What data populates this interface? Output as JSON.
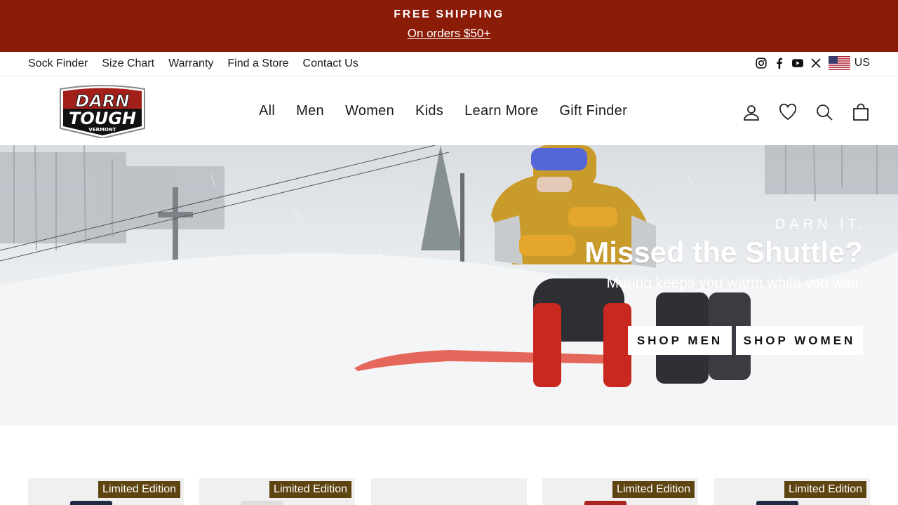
{
  "announcement": {
    "title": "FREE SHIPPING",
    "link": "On orders $50+"
  },
  "utility": {
    "links": [
      "Sock Finder",
      "Size Chart",
      "Warranty",
      "Find a Store",
      "Contact Us"
    ],
    "social_icons": [
      "instagram-icon",
      "facebook-icon",
      "youtube-icon",
      "x-icon"
    ],
    "locale": "US",
    "flag_icon": "us-flag-icon"
  },
  "header": {
    "logo": {
      "line1": "DARN",
      "line2": "TOUGH",
      "line3": "VERMONT"
    },
    "nav": [
      "All",
      "Men",
      "Women",
      "Kids",
      "Learn More",
      "Gift Finder"
    ],
    "icons": [
      "account-icon",
      "wishlist-heart-icon",
      "search-icon",
      "cart-icon"
    ]
  },
  "hero": {
    "eyebrow": "DARN IT.",
    "title": "Missed the Shuttle?",
    "subtitle": "Merino keeps you warm while you wait.",
    "buttons": {
      "men": "SHOP MEN",
      "women": "SHOP WOMEN"
    }
  },
  "products": {
    "badges": [
      "Limited Edition",
      "Limited Edition",
      "",
      "Limited Edition",
      "Limited Edition"
    ]
  },
  "colors": {
    "announcement_bg": "#8b1c08",
    "badge_bg": "#5e4410",
    "logo_red": "#a3201a"
  }
}
